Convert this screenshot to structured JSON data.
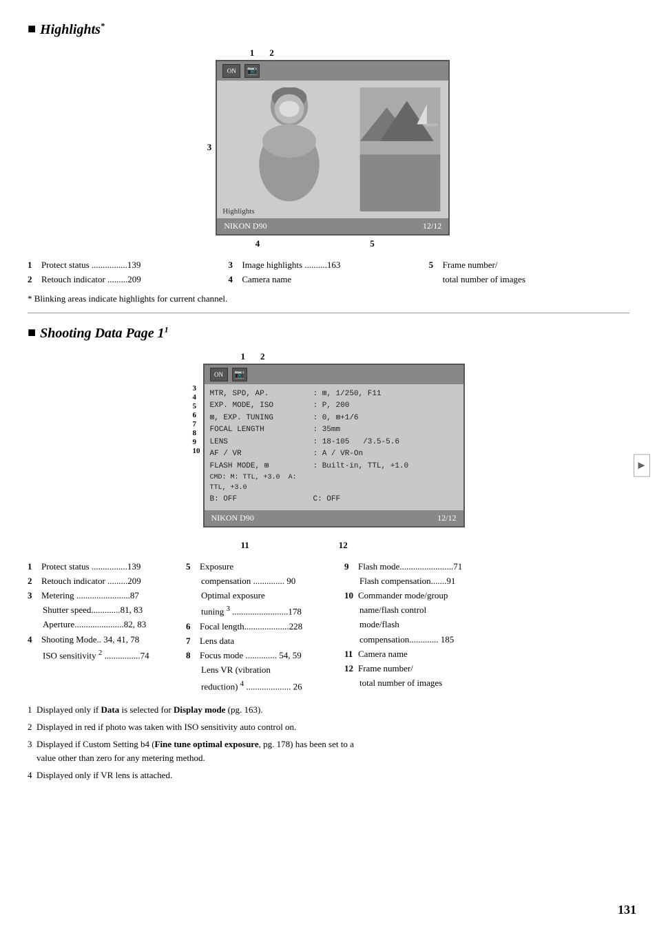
{
  "page": {
    "number": "131"
  },
  "highlights_section": {
    "title": "Highlights",
    "star": "*",
    "icon": "■",
    "camera_screen": {
      "label_1": "1",
      "label_2": "2",
      "label_3": "3",
      "label_4": "4",
      "label_5": "5",
      "bottom_left": "NIKON D90",
      "bottom_right": "12/12",
      "overlay_text": "Highlights"
    },
    "info_items": [
      {
        "num": "1",
        "text": "Protect status ................139"
      },
      {
        "num": "2",
        "text": "Retouch indicator .........209"
      }
    ],
    "info_items_mid": [
      {
        "num": "3",
        "text": "Image highlights ..........163"
      },
      {
        "num": "4",
        "text": "Camera name"
      }
    ],
    "info_items_right": [
      {
        "num": "5",
        "text": "Frame number/"
      },
      {
        "num": "",
        "text": "      total number of images"
      }
    ],
    "footnote": "* Blinking areas indicate highlights for current channel."
  },
  "shooting_section": {
    "title": "Shooting Data Page 1",
    "superscript": "1",
    "icon": "■",
    "camera_screen": {
      "label_1": "1",
      "label_2": "2",
      "label_3": "3",
      "label_4": "4",
      "label_5": "5",
      "label_6": "6",
      "label_7": "7",
      "label_8": "8",
      "label_9": "9",
      "label_10": "10",
      "label_11": "11",
      "label_12": "12",
      "bottom_left": "NIKON D90",
      "bottom_right": "12/12",
      "data_rows": [
        {
          "label": "MTR, SPD, AP.",
          "value": ":⊞, 1/250, F11"
        },
        {
          "label": "EXP. MODE, ISO",
          "value": ": P, 200"
        },
        {
          "label": "⊠, EXP. TUNING",
          "value": ": 0, ⊞+1/6"
        },
        {
          "label": "FOCAL LENGTH",
          "value": ": 35mm"
        },
        {
          "label": "LENS",
          "value": ": 18-105   /3.5-5.6"
        },
        {
          "label": "AF / VR",
          "value": ": A / VR-On"
        },
        {
          "label": "FLASH MODE, ⊞",
          "value": ": Built-in, TTL, +1.0"
        },
        {
          "label": "CMD: M: TTL, +3.0",
          "value": "A: TTL, +3.0"
        },
        {
          "label": "B: OFF",
          "value": "C: OFF"
        }
      ]
    },
    "info_col1": [
      {
        "num": "1",
        "label": "Protect status ................139"
      },
      {
        "num": "2",
        "label": "Retouch indicator .........209"
      },
      {
        "num": "3",
        "label": "Metering ........................87",
        "subs": [
          "Shutter speed.............81, 83",
          "Aperture......................82, 83"
        ]
      },
      {
        "num": "4",
        "label": "Shooting Mode.. 34, 41, 78",
        "subs": [
          "ISO sensitivity 2 ................74"
        ]
      }
    ],
    "info_col2": [
      {
        "num": "5",
        "label": "Exposure",
        "subs": [
          "compensation .............. 90",
          "Optimal exposure",
          "tuning 3 .........................178"
        ]
      },
      {
        "num": "6",
        "label": "Focal length....................228"
      },
      {
        "num": "7",
        "label": "Lens data"
      },
      {
        "num": "8",
        "label": "Focus mode .............. 54, 59",
        "subs": [
          "Lens VR (vibration",
          "reduction) 4 .................... 26"
        ]
      }
    ],
    "info_col3": [
      {
        "num": "9",
        "label": "Flash mode........................71",
        "subs": [
          "Flash compensation.......91"
        ]
      },
      {
        "num": "10",
        "label": "Commander mode/group",
        "subs": [
          "name/flash control",
          "mode/flash",
          "compensation............. 185"
        ]
      },
      {
        "num": "11",
        "label": "Camera name"
      },
      {
        "num": "12",
        "label": "Frame number/",
        "subs": [
          "total number of images"
        ]
      }
    ],
    "footnotes": [
      {
        "num": "1",
        "text": "Displayed only if Data is selected for Display mode (pg. 163)."
      },
      {
        "num": "2",
        "text": "Displayed in red if photo was taken with ISO sensitivity auto control on."
      },
      {
        "num": "3",
        "text": "Displayed if Custom Setting b4 (Fine tune optimal exposure, pg. 178) has been set to a value other than zero for any metering method."
      },
      {
        "num": "4",
        "text": "Displayed only if VR lens is attached."
      }
    ]
  }
}
